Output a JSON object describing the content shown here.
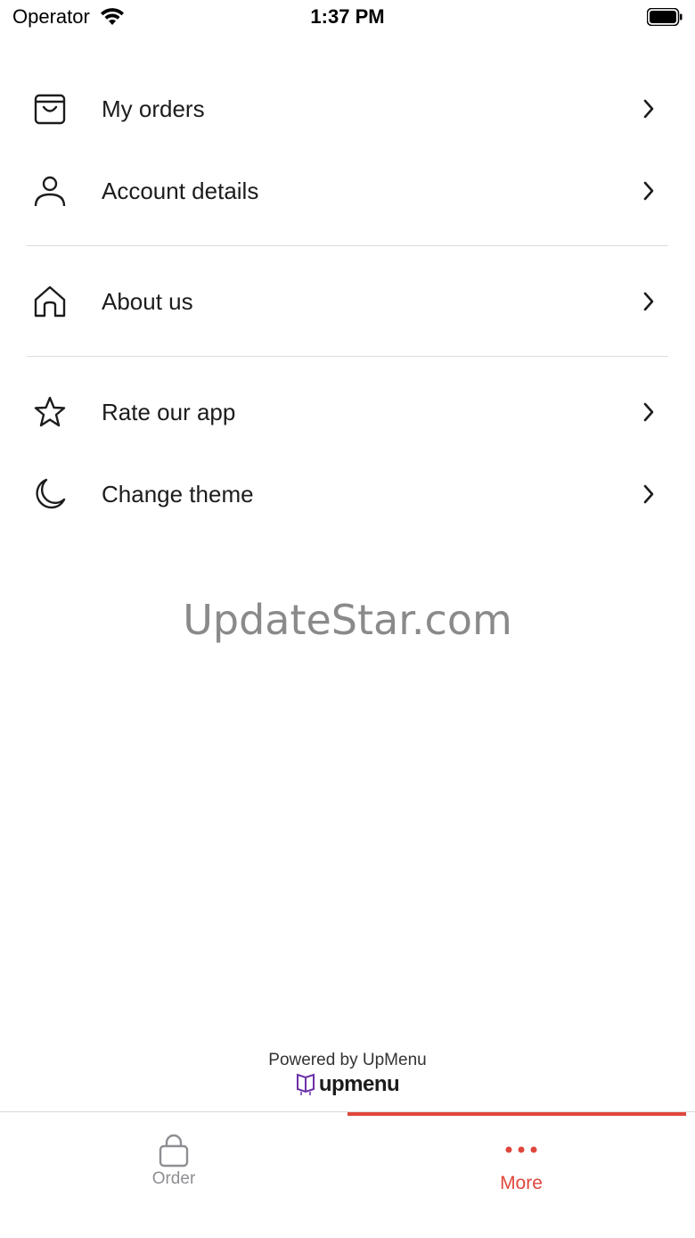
{
  "status_bar": {
    "carrier": "Operator",
    "time": "1:37 PM"
  },
  "menu": {
    "items": [
      {
        "label": "My orders",
        "icon": "shopping-bag-icon"
      },
      {
        "label": "Account details",
        "icon": "user-icon"
      },
      {
        "label": "About us",
        "icon": "home-icon"
      },
      {
        "label": "Rate our app",
        "icon": "star-icon"
      },
      {
        "label": "Change theme",
        "icon": "moon-icon"
      }
    ]
  },
  "watermark": "UpdateStar.com",
  "footer": {
    "powered_by": "Powered by UpMenu",
    "brand": "upmenu"
  },
  "tab_bar": {
    "tabs": [
      {
        "label": "Order",
        "icon": "bag-icon",
        "active": false
      },
      {
        "label": "More",
        "icon": "more-dots-icon",
        "active": true
      }
    ]
  },
  "colors": {
    "accent": "#e0463c",
    "inactive": "#8e8e93",
    "brand_purple": "#6b2fa8"
  }
}
